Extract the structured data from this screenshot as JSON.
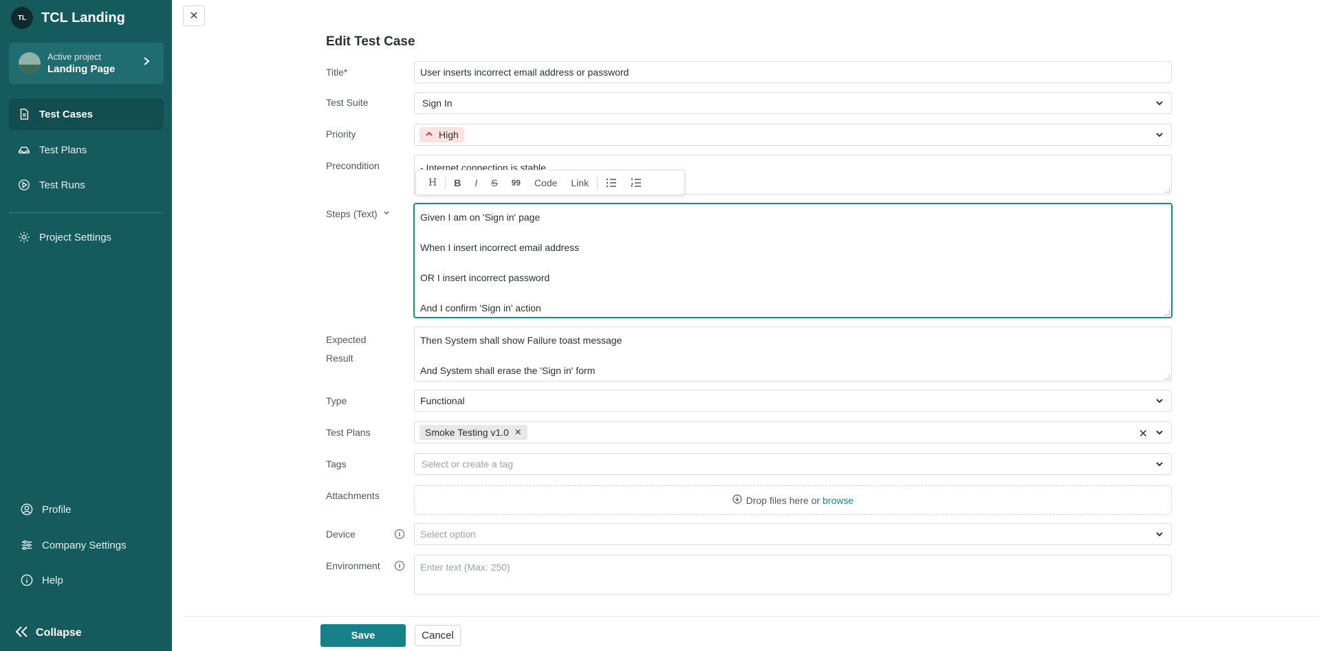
{
  "sidebar": {
    "brand_initials": "TL",
    "brand_name": "TCL Landing",
    "project": {
      "subtitle": "Active project",
      "name": "Landing Page"
    },
    "nav": [
      {
        "label": "Test Cases",
        "icon": "document-icon",
        "active": true
      },
      {
        "label": "Test Plans",
        "icon": "plans-icon",
        "active": false
      },
      {
        "label": "Test Runs",
        "icon": "play-circle-icon",
        "active": false
      }
    ],
    "project_settings": "Project Settings",
    "bottom": [
      {
        "label": "Profile",
        "icon": "user-icon"
      },
      {
        "label": "Company Settings",
        "icon": "sliders-icon"
      },
      {
        "label": "Help",
        "icon": "info-icon"
      }
    ],
    "collapse_label": "Collapse"
  },
  "form": {
    "title": "Edit Test Case",
    "title_label": "Title*",
    "title_value": "User inserts incorrect email address or password",
    "suite_label": "Test Suite",
    "suite_value": "Sign In",
    "priority_label": "Priority",
    "priority_value": "High",
    "precondition_label": "Precondition",
    "precondition_value": "- Internet connection is stable",
    "toolbar": [
      "H",
      "B",
      "I",
      "S",
      "99",
      "Code",
      "Link"
    ],
    "steps_label": "Steps (Text)",
    "steps": [
      "Given I am on 'Sign in' page",
      "When I insert incorrect email address",
      "OR I insert incorrect password",
      "And I confirm 'Sign in' action"
    ],
    "expected_label_1": "Expected",
    "expected_label_2": "Result",
    "expected": [
      "Then System shall show Failure toast message",
      "And System shall erase the 'Sign in' form"
    ],
    "type_label": "Type",
    "type_value": "Functional",
    "plans_label": "Test Plans",
    "plans_chip": "Smoke Testing v1.0",
    "tags_label": "Tags",
    "tags_placeholder": "Select or create a tag",
    "attachments_label": "Attachments",
    "drop_text": "Drop files here or",
    "browse_text": "browse",
    "device_label": "Device",
    "device_placeholder": "Select option",
    "environment_label": "Environment",
    "environment_placeholder": "Enter text (Max: 250)",
    "save_label": "Save",
    "cancel_label": "Cancel"
  },
  "colors": {
    "sidebar": "#155b5e",
    "accent": "#17818a",
    "priority_bg": "#fde2e2"
  }
}
